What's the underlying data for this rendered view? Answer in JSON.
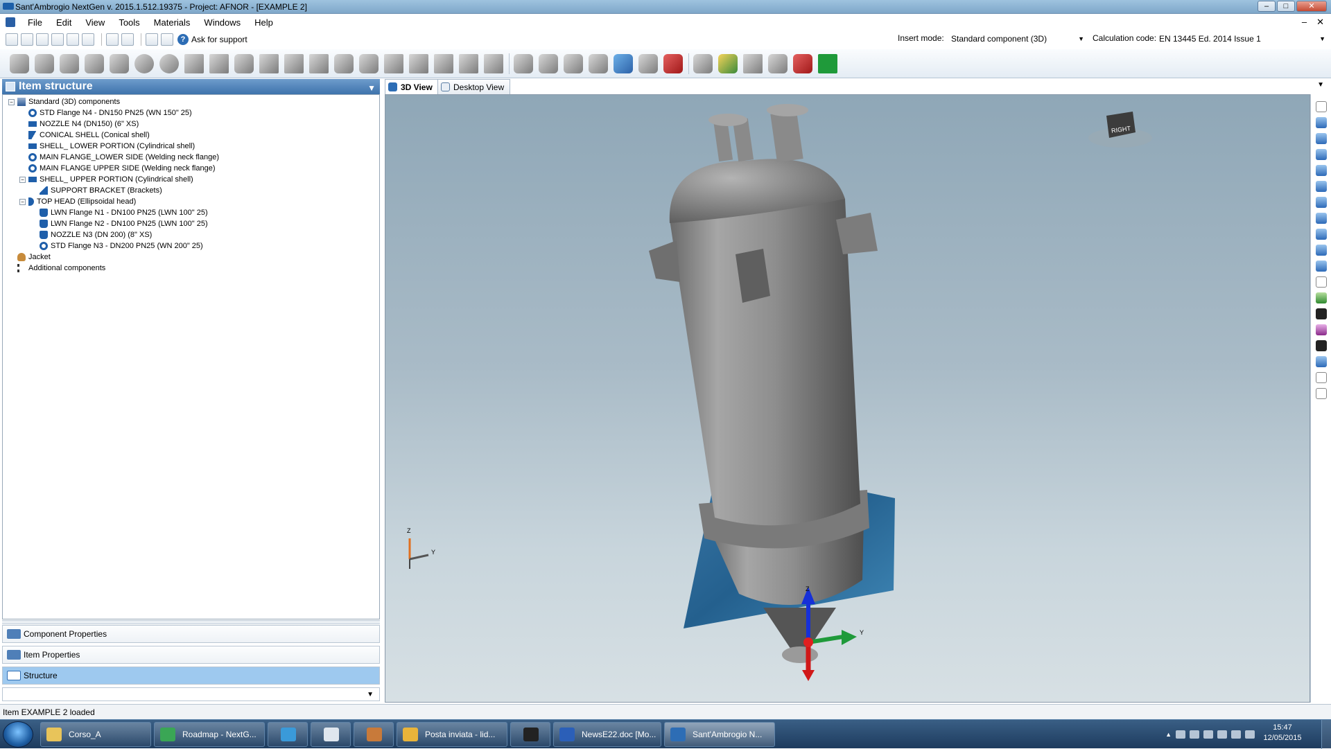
{
  "window": {
    "title": "Sant'Ambrogio NextGen  v. 2015.1.512.19375 - Project: AFNOR - [EXAMPLE 2]",
    "min": "–",
    "max": "□",
    "close": "✕"
  },
  "menu": {
    "items": [
      "File",
      "Edit",
      "View",
      "Tools",
      "Materials",
      "Windows",
      "Help"
    ],
    "mdi_min": "–",
    "mdi_close": "✕"
  },
  "toolbar": {
    "help_label": "Ask for support",
    "insert_mode_label": "Insert mode:",
    "insert_mode_value": "Standard component (3D)",
    "calc_code_label": "Calculation code:",
    "calc_code_value": "EN 13445 Ed. 2014 Issue 1"
  },
  "item_structure": {
    "title": "Item structure",
    "pin": "▼",
    "tree": [
      {
        "label": "Standard (3D) components",
        "indent": 0,
        "exp": "−",
        "icon": "std"
      },
      {
        "label": "STD Flange N4 - DN150 PN25 (WN 150\" 25)",
        "indent": 1,
        "icon": "flange"
      },
      {
        "label": "NOZZLE N4 (DN150) (6\" XS)",
        "indent": 1,
        "icon": "shell"
      },
      {
        "label": "CONICAL SHELL (Conical shell)",
        "indent": 1,
        "icon": "cone"
      },
      {
        "label": "SHELL_ LOWER PORTION (Cylindrical shell)",
        "indent": 1,
        "icon": "shell"
      },
      {
        "label": "MAIN FLANGE_LOWER SIDE (Welding neck flange)",
        "indent": 1,
        "icon": "flange"
      },
      {
        "label": "MAIN FLANGE UPPER SIDE (Welding neck flange)",
        "indent": 1,
        "icon": "flange"
      },
      {
        "label": "SHELL_ UPPER PORTION (Cylindrical shell)",
        "indent": 1,
        "exp": "−",
        "icon": "shell"
      },
      {
        "label": "SUPPORT BRACKET (Brackets)",
        "indent": 2,
        "icon": "brk"
      },
      {
        "label": "TOP HEAD (Ellipsoidal head)",
        "indent": 1,
        "exp": "−",
        "icon": "head"
      },
      {
        "label": "LWN Flange N1 - DN100 PN25 (LWN 100\" 25)",
        "indent": 2,
        "icon": "lwn"
      },
      {
        "label": "LWN Flange N2 - DN100 PN25 (LWN 100\" 25)",
        "indent": 2,
        "icon": "lwn"
      },
      {
        "label": "NOZZLE N3 (DN 200) (8\" XS)",
        "indent": 2,
        "icon": "lwn"
      },
      {
        "label": "STD Flange N3 - DN200 PN25 (WN 200\" 25)",
        "indent": 2,
        "icon": "flange"
      },
      {
        "label": "Jacket",
        "indent": 0,
        "icon": "jkt"
      },
      {
        "label": "Additional components",
        "indent": 0,
        "icon": "add"
      }
    ]
  },
  "panels": {
    "component_properties": "Component Properties",
    "item_properties": "Item Properties",
    "structure": "Structure",
    "dropdown_arrow": "▼"
  },
  "tabs": {
    "view3d": "3D View",
    "desktop": "Desktop View",
    "menu_arrow": "▼"
  },
  "viewport": {
    "cube_label": "RIGHT",
    "axis_z": "Z",
    "axis_y": "Y",
    "gizmo_z": "Z",
    "gizmo_y": "Y"
  },
  "status": {
    "text": "Item EXAMPLE 2 loaded"
  },
  "taskbar": {
    "items": [
      {
        "label": "Corso_A",
        "icon_color": "#e8c45a"
      },
      {
        "label": "Roadmap - NextG...",
        "icon_color": "#3aa655"
      },
      {
        "label": "",
        "icon_color": "#3a9ad9"
      },
      {
        "label": "",
        "icon_color": "#dfe6ee"
      },
      {
        "label": "",
        "icon_color": "#c87a3a"
      },
      {
        "label": "Posta inviata - lid...",
        "icon_color": "#e9b43a"
      },
      {
        "label": "",
        "icon_color": "#222222"
      },
      {
        "label": "NewsE22.doc [Mo...",
        "icon_color": "#2b5fb8"
      },
      {
        "label": "Sant'Ambrogio N...",
        "icon_color": "#2d6db5"
      }
    ],
    "clock_time": "15:47",
    "clock_date": "12/05/2015"
  },
  "colors": {
    "title_accent": "#1c5fa8",
    "panel_header": "#3e73ac",
    "selected_row": "#9ec9ef",
    "viewport_top": "#8fa7b7",
    "viewport_bottom": "#d7e0e4"
  }
}
